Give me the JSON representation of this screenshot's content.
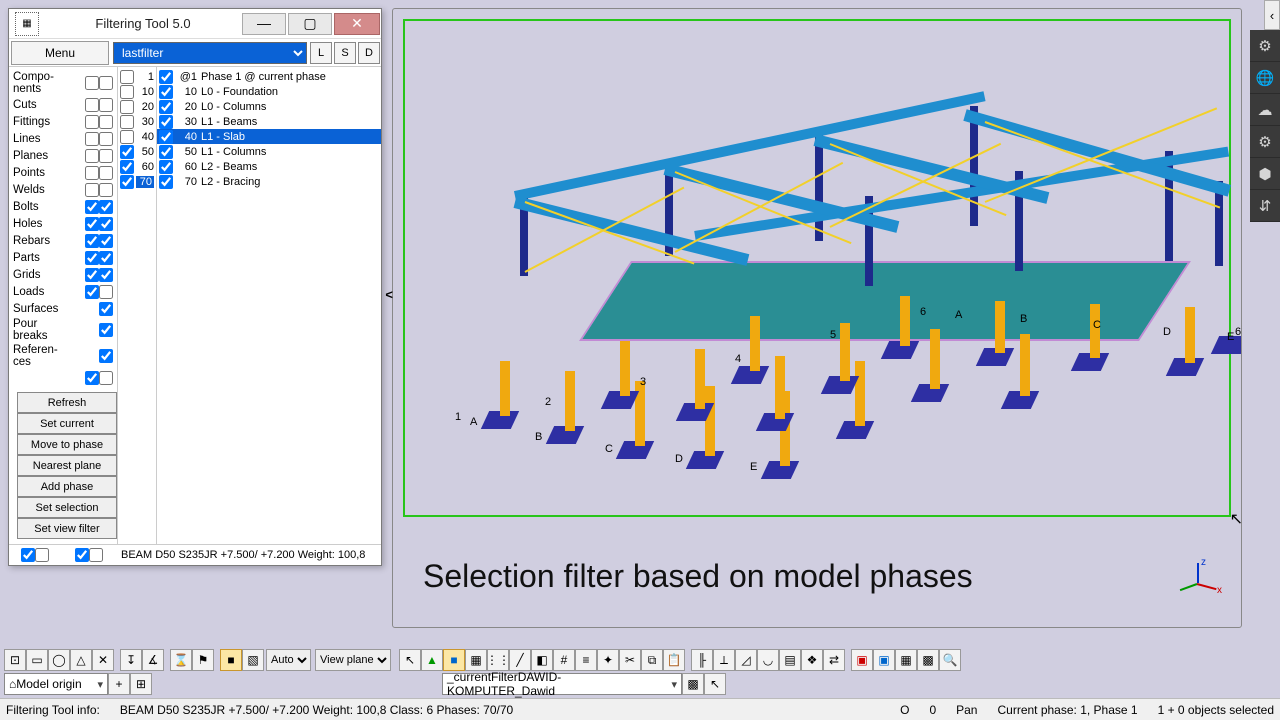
{
  "window": {
    "title": "Filtering Tool 5.0",
    "min": "—",
    "max": "▢",
    "close": "✕"
  },
  "toolbar": {
    "menu": "Menu",
    "filter_value": "lastfilter",
    "L": "L",
    "S": "S",
    "D": "D"
  },
  "categories": [
    "Compo-\n  nents",
    "Cuts",
    "Fittings",
    "Lines",
    "Planes",
    "Points",
    "Welds",
    "Bolts",
    "Holes",
    "Rebars",
    "Parts",
    "Grids",
    "Loads",
    "Surfaces",
    "Pour\n  breaks",
    "Referen-\n  ces"
  ],
  "numcol": [
    {
      "n": "1",
      "c": false
    },
    {
      "n": "10",
      "c": false
    },
    {
      "n": "20",
      "c": false
    },
    {
      "n": "30",
      "c": false
    },
    {
      "n": "40",
      "c": false
    },
    {
      "n": "50",
      "c": true
    },
    {
      "n": "60",
      "c": true
    },
    {
      "n": "70",
      "c": true
    }
  ],
  "phases": [
    {
      "id": "@1",
      "label": "Phase 1    @ current phase",
      "sel": false
    },
    {
      "id": "10",
      "label": "L0 - Foundation",
      "sel": false
    },
    {
      "id": "20",
      "label": "L0 - Columns",
      "sel": false
    },
    {
      "id": "30",
      "label": "L1 - Beams",
      "sel": false
    },
    {
      "id": "40",
      "label": "L1 - Slab",
      "sel": true
    },
    {
      "id": "50",
      "label": "L1 - Columns",
      "sel": false
    },
    {
      "id": "60",
      "label": "L2 - Beams",
      "sel": false
    },
    {
      "id": "70",
      "label": "L2 - Bracing",
      "sel": false
    }
  ],
  "funcs": [
    "Refresh",
    "Set current",
    "Move to phase",
    "Nearest plane",
    "Add phase",
    "Set selection",
    "Set view filter"
  ],
  "info_panel": "BEAM D50  S235JR  +7.500/ +7.200 Weight: 100,8",
  "collapse": "<",
  "viewport": {
    "caption": "Selection filter based on model phases",
    "grid_letters": [
      "A",
      "B",
      "C",
      "D",
      "E"
    ],
    "grid_numbers": [
      "1",
      "2",
      "3",
      "4",
      "5",
      "6"
    ]
  },
  "right_buttons": [
    "⚙",
    "🌐",
    "☁",
    "⚙",
    "⬢",
    "⇵"
  ],
  "right_tab": "‹",
  "btoolbar": {
    "auto": "Auto",
    "viewplane": "View plane",
    "model_origin": "Model origin",
    "current_filter": "_currentFilterDAWID-KOMPUTER_Dawid"
  },
  "status": {
    "prefix": "Filtering Tool info:",
    "text": "BEAM D50  S235JR  +7.500/ +7.200 Weight: 100,8 Class: 6 Phases: 70/70",
    "origin": "O",
    "origin_val": "0",
    "mode": "Pan",
    "phase": "Current phase: 1, Phase 1",
    "sel": "1 + 0 objects selected"
  }
}
